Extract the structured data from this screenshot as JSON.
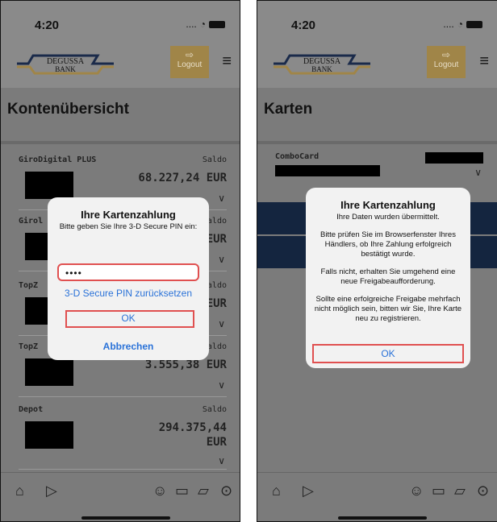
{
  "status": {
    "time": "4:20",
    "signal_dots": "....",
    "wifi": "wifi-icon",
    "battery": "battery-icon"
  },
  "header": {
    "brand_line1": "DEGUSSA",
    "brand_line2": "BANK",
    "logout_label": "Logout"
  },
  "left": {
    "title": "Kontenübersicht",
    "accounts": [
      {
        "name": "GiroDigital PLUS",
        "saldo_label": "Saldo",
        "amount": "68.227,24 EUR"
      },
      {
        "name": "Girol",
        "saldo_label": "Saldo",
        "amount": "EUR"
      },
      {
        "name": "TopZ",
        "saldo_label": "Saldo",
        "amount": "EUR"
      },
      {
        "name": "TopZ",
        "saldo_label": "Saldo",
        "amount": "3.555,38 EUR"
      },
      {
        "name": "Depot",
        "saldo_label": "Saldo",
        "amount": "294.375,44",
        "amount2": "EUR"
      }
    ],
    "dialog": {
      "title": "Ihre Kartenzahlung",
      "message": "Bitte geben Sie Ihre 3-D Secure PIN ein:",
      "pin_value": "••••",
      "reset_label": "3-D Secure PIN zurücksetzen",
      "ok_label": "OK",
      "cancel_label": "Abbrechen"
    }
  },
  "right": {
    "title": "Karten",
    "card_name": "ComboCard",
    "dialog": {
      "title": "Ihre Kartenzahlung",
      "line1": "Ihre Daten wurden übermittelt.",
      "para1": "Bitte prüfen Sie im Browserfenster Ihres Händlers, ob Ihre Zahlung erfolgreich bestätigt wurde.",
      "para2": "Falls nicht, erhalten Sie umgehend eine neue Freigabeaufforderung.",
      "para3": "Sollte eine erfolgreiche Freigabe mehrfach nicht möglich sein, bitten wir Sie, Ihre Karte neu zu registrieren.",
      "ok_label": "OK"
    }
  },
  "colors": {
    "gold": "#a08548",
    "navy": "#14253f",
    "link": "#2a72d8",
    "highlight": "#e05050"
  }
}
